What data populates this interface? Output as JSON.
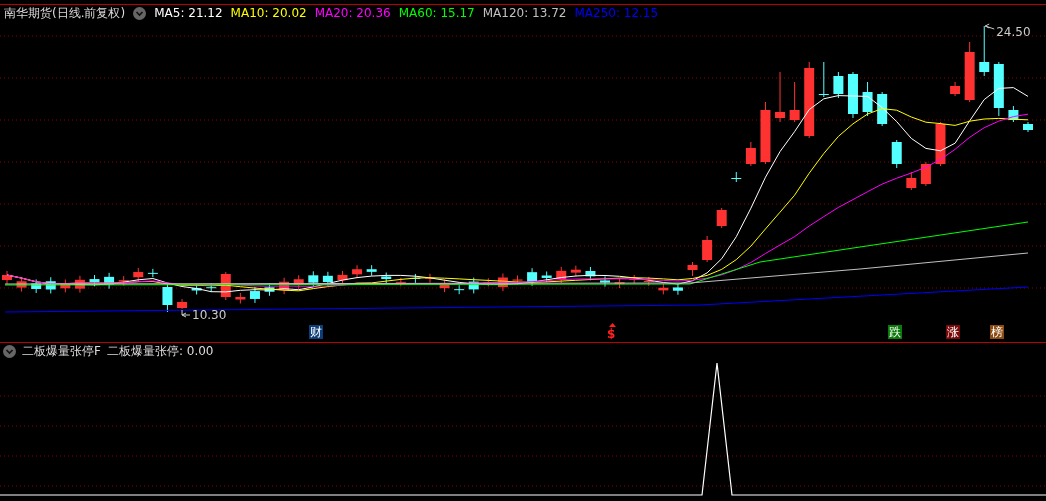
{
  "chart_title": "南华期货(日线.前复权)",
  "ma_legend": [
    {
      "label": "MA5: 21.12",
      "color": "#ffffff"
    },
    {
      "label": "MA10: 20.02",
      "color": "#ffff00"
    },
    {
      "label": "MA20: 20.36",
      "color": "#ff00ff"
    },
    {
      "label": "MA60: 15.17",
      "color": "#00ff00"
    },
    {
      "label": "MA120: 13.72",
      "color": "#c0c0c0"
    },
    {
      "label": "MA250: 12.15",
      "color": "#0000ff"
    }
  ],
  "high_label": "24.50",
  "low_label": "10.30",
  "event_markers": [
    {
      "label": "财",
      "kind": "badge",
      "color": "#0a3d7a"
    },
    {
      "label": "$",
      "kind": "arrow",
      "color": "#ff2020"
    },
    {
      "label": "跌",
      "kind": "badge",
      "color": "#0a7a0a"
    },
    {
      "label": "涨",
      "kind": "badge",
      "color": "#7a0a0a"
    },
    {
      "label": "榜",
      "kind": "badge",
      "color": "#8a4a10"
    }
  ],
  "indicator_title": "二板爆量张停F",
  "indicator_reading": "二板爆量张停: 0.00"
}
